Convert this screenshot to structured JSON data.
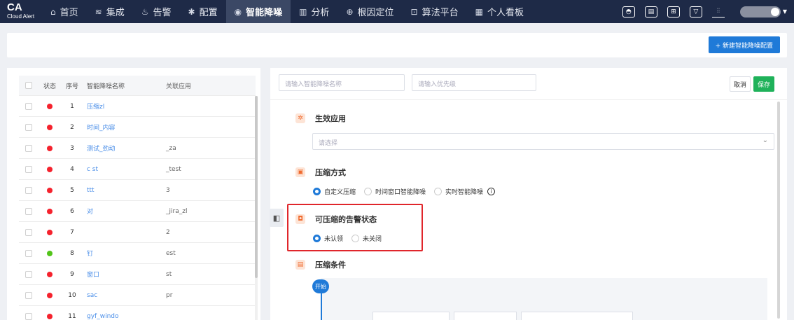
{
  "logo": {
    "title": "CA",
    "subtitle": "Cloud Alert"
  },
  "nav": {
    "items": [
      {
        "label": "首页",
        "icon": "home-icon",
        "glyph": "⌂"
      },
      {
        "label": "集成",
        "icon": "layers-icon",
        "glyph": "≋"
      },
      {
        "label": "告警",
        "icon": "alarm-icon",
        "glyph": "♨"
      },
      {
        "label": "配置",
        "icon": "gear-icon",
        "glyph": "✱"
      },
      {
        "label": "智能降噪",
        "icon": "noise-reduction-icon",
        "glyph": "◉"
      },
      {
        "label": "分析",
        "icon": "chart-icon",
        "glyph": "▥"
      },
      {
        "label": "根因定位",
        "icon": "target-icon",
        "glyph": "⊕"
      },
      {
        "label": "算法平台",
        "icon": "algorithm-icon",
        "glyph": "⊡"
      },
      {
        "label": "个人看板",
        "icon": "dashboard-icon",
        "glyph": "▦"
      }
    ],
    "active_index": 4
  },
  "header": {
    "create_button": "+ 新建智能降噪配置"
  },
  "table": {
    "columns": {
      "status": "状态",
      "index": "序号",
      "name": "智能降噪名称",
      "app": "关联应用"
    },
    "rows": [
      {
        "index": "1",
        "name": "压缩zl",
        "app": "",
        "status": "red"
      },
      {
        "index": "2",
        "name": "时间_内容",
        "app": "",
        "status": "red"
      },
      {
        "index": "3",
        "name": "测试_劲动",
        "app": "_za",
        "status": "red"
      },
      {
        "index": "4",
        "name": "c st",
        "app": "_test",
        "status": "red"
      },
      {
        "index": "5",
        "name": "ttt",
        "app": "3",
        "status": "red"
      },
      {
        "index": "6",
        "name": "对",
        "app": "_jira_zl",
        "status": "red"
      },
      {
        "index": "7",
        "name": "",
        "app": "2",
        "status": "red"
      },
      {
        "index": "8",
        "name": "钉",
        "app": "est",
        "status": "green"
      },
      {
        "index": "9",
        "name": "窗口",
        "app": "st",
        "status": "red"
      },
      {
        "index": "10",
        "name": "sac",
        "app": "pr",
        "status": "red"
      },
      {
        "index": "11",
        "name": "gyf_windo",
        "app": "",
        "status": "red"
      }
    ]
  },
  "colors": {
    "red": "#f5222d",
    "green": "#52c41a",
    "primary": "#1f7ad8",
    "save": "#1fb25a",
    "highlight": "#e0262b"
  },
  "form": {
    "name_placeholder": "请输入智能降噪名称",
    "priority_placeholder": "请输入优先级",
    "cancel": "取消",
    "save": "保存",
    "section_apply": "生效应用",
    "select_placeholder": "请选择",
    "section_method": "压缩方式",
    "methods": [
      "自定义压缩",
      "时间窗口智能降噪",
      "实时智能降噪"
    ],
    "section_state": "可压缩的告警状态",
    "states": [
      "未认领",
      "未关闭"
    ],
    "section_condition": "压缩条件",
    "start": "开始"
  }
}
